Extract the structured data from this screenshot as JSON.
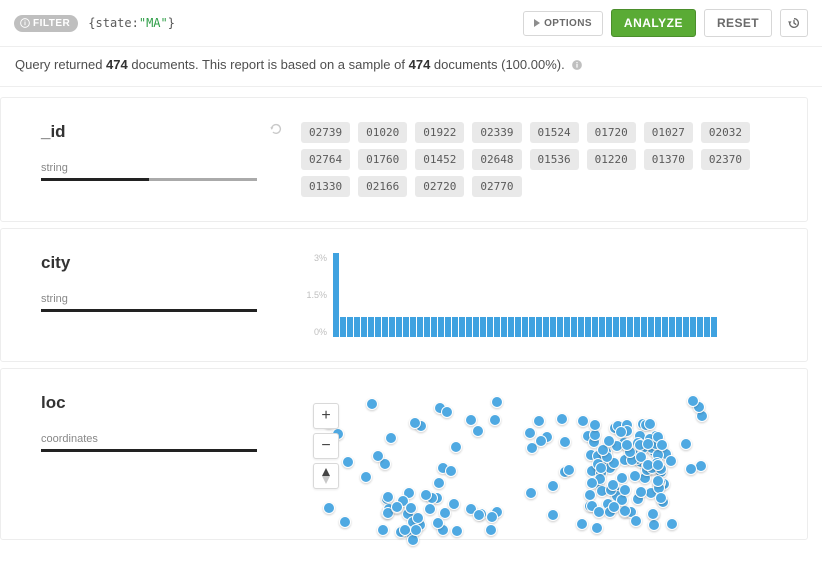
{
  "querybar": {
    "filter_label": "FILTER",
    "brace_open": "{",
    "brace_close": "}",
    "query_property": "state",
    "colon": ":",
    "query_value": "\"MA\"",
    "options_label": "OPTIONS",
    "analyze_label": "ANALYZE",
    "reset_label": "RESET"
  },
  "status": {
    "prefix": "Query returned ",
    "returned_count": "474",
    "mid": " documents. This report is based on a sample of ",
    "sample_count": "474",
    "suffix": " documents (100.00%)."
  },
  "panels": {
    "id": {
      "name": "_id",
      "type": "string",
      "chips": [
        "02739",
        "01020",
        "01922",
        "02339",
        "01524",
        "01720",
        "01027",
        "02032",
        "02764",
        "01760",
        "01452",
        "02648",
        "01536",
        "01220",
        "01370",
        "02370",
        "01330",
        "02166",
        "02720",
        "02770"
      ]
    },
    "city": {
      "name": "city",
      "type": "string"
    },
    "loc": {
      "name": "loc",
      "type": "coordinates",
      "map": {
        "zoom_in": "+",
        "zoom_out": "−",
        "points_seed": 474
      }
    }
  },
  "chart_data": {
    "type": "bar",
    "title": "",
    "xlabel": "",
    "ylabel": "",
    "ylim": [
      0,
      3
    ],
    "y_ticks": [
      "3%",
      "1.5%",
      "0%"
    ],
    "categories_count": 55,
    "values": [
      3.0,
      0.7,
      0.7,
      0.7,
      0.7,
      0.7,
      0.7,
      0.7,
      0.7,
      0.7,
      0.7,
      0.7,
      0.7,
      0.7,
      0.7,
      0.7,
      0.7,
      0.7,
      0.7,
      0.7,
      0.7,
      0.7,
      0.7,
      0.7,
      0.7,
      0.7,
      0.7,
      0.7,
      0.7,
      0.7,
      0.7,
      0.7,
      0.7,
      0.7,
      0.7,
      0.7,
      0.7,
      0.7,
      0.7,
      0.7,
      0.7,
      0.7,
      0.7,
      0.7,
      0.7,
      0.7,
      0.7,
      0.7,
      0.7,
      0.7,
      0.7,
      0.7,
      0.7,
      0.7,
      0.7
    ]
  },
  "colors": {
    "accent_green": "#5aab35",
    "chip_bg": "#e9e9e9",
    "bar_blue": "#3fa2e0",
    "map_dot": "#4fa9e2"
  }
}
